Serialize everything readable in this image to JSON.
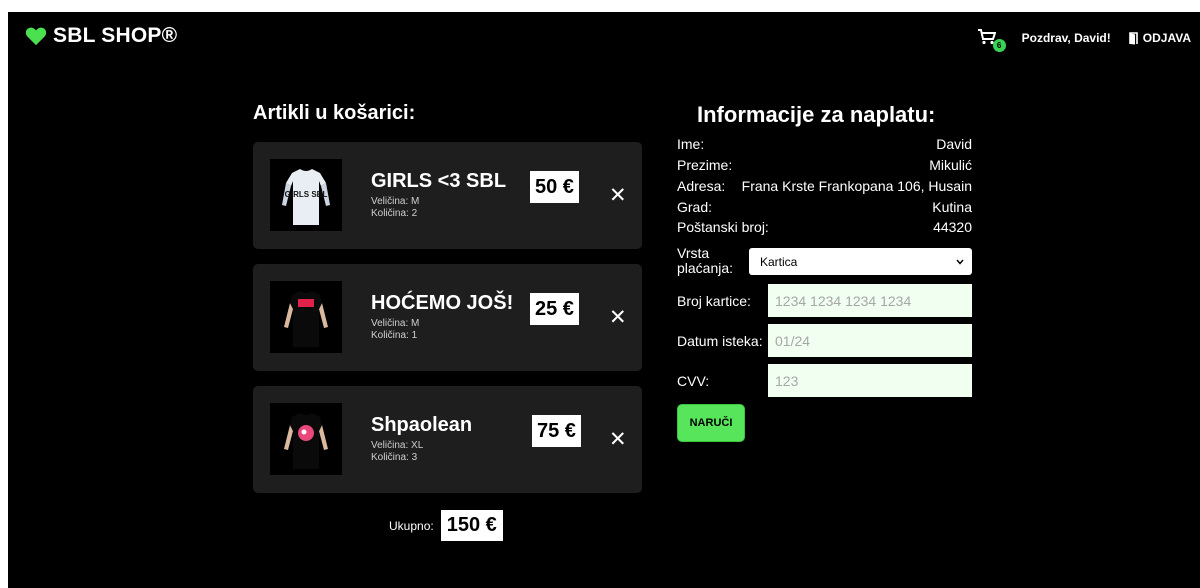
{
  "header": {
    "brand": "SBL SHOP®",
    "cart_count": "6",
    "greeting": "Pozdrav, David!",
    "logout": "ODJAVA"
  },
  "cart": {
    "title": "Artikli u košarici:",
    "items": [
      {
        "name": "GIRLS <3 SBL",
        "size": "Veličina: M",
        "qty": "Količina: 2",
        "price": "50 €",
        "shirt_print": "GIRLS SBL"
      },
      {
        "name": "HOĆEMO JOŠ!",
        "size": "Veličina: M",
        "qty": "Količina: 1",
        "price": "25 €"
      },
      {
        "name": "Shpaolean",
        "size": "Veličina: XL",
        "qty": "Količina: 3",
        "price": "75 €"
      }
    ],
    "remove_symbol": "✕",
    "total_label": "Ukupno:",
    "total_value": "150 €"
  },
  "billing": {
    "title": "Informacije za naplatu:",
    "rows": [
      {
        "label": "Ime:",
        "value": "David"
      },
      {
        "label": "Prezime:",
        "value": "Mikulić"
      },
      {
        "label": "Adresa:",
        "value": "Frana Krste Frankopana 106, Husain"
      },
      {
        "label": "Grad:",
        "value": "Kutina"
      },
      {
        "label": "Poštanski broj:",
        "value": "44320"
      }
    ],
    "payment_label": "Vrsta plaćanja:",
    "payment_selected": "Kartica",
    "card_label": "Broj kartice:",
    "card_placeholder": "1234 1234 1234 1234",
    "expiry_label": "Datum isteka:",
    "expiry_placeholder": "01/24",
    "cvv_label": "CVV:",
    "cvv_placeholder": "123",
    "order_button": "NARUČI"
  },
  "colors": {
    "accent": "#57e65b",
    "background": "#000000",
    "card": "#1e1e1e"
  },
  "icons": [
    "heart-icon",
    "cart-icon",
    "logout-door-icon",
    "close-icon",
    "chevron-down-icon"
  ]
}
